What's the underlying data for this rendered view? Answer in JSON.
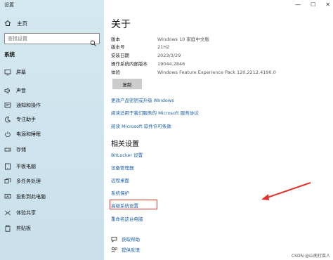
{
  "window": {
    "title": "设置"
  },
  "sidebar": {
    "home_label": "主页",
    "search_placeholder": "查找设置",
    "section_title": "系统",
    "items": [
      {
        "label": "屏幕",
        "icon": "monitor-icon"
      },
      {
        "label": "声音",
        "icon": "speaker-icon"
      },
      {
        "label": "通知和操作",
        "icon": "notification-icon"
      },
      {
        "label": "专注助手",
        "icon": "moon-icon"
      },
      {
        "label": "电源和睡眠",
        "icon": "power-icon"
      },
      {
        "label": "存储",
        "icon": "storage-icon"
      },
      {
        "label": "平板电脑",
        "icon": "tablet-icon"
      },
      {
        "label": "多任务处理",
        "icon": "multitask-icon"
      },
      {
        "label": "投影到此电脑",
        "icon": "project-icon"
      },
      {
        "label": "体验共享",
        "icon": "share-icon"
      },
      {
        "label": "剪贴板",
        "icon": "clipboard-icon"
      }
    ]
  },
  "main": {
    "title": "关于",
    "specs": [
      {
        "key": "版本",
        "value": "Windows 10 家庭中文版"
      },
      {
        "key": "版本号",
        "value": "21H2"
      },
      {
        "key": "安装日期",
        "value": "2023/3/29"
      },
      {
        "key": "操作系统内部版本",
        "value": "19044.2846"
      },
      {
        "key": "体验",
        "value": "Windows Feature Experience Pack 120.2212.4190.0"
      }
    ],
    "copy_label": "复制",
    "links_top": [
      "更改产品密钥或升级 Windows",
      "阅读适用于我们服务的 Microsoft 服务协议",
      "阅读 Microsoft 软件许可条款"
    ],
    "related_title": "相关设置",
    "related_links": [
      "BitLocker 设置",
      "设备管理器",
      "远程桌面",
      "系统保护",
      "高级系统设置",
      "重命名这台电脑"
    ],
    "help_links": [
      {
        "label": "获取帮助",
        "icon": "help-chat-icon"
      },
      {
        "label": "提供反馈",
        "icon": "feedback-icon"
      }
    ]
  },
  "watermark": "CSDN @山南打菜人",
  "colors": {
    "link": "#1a5fa8",
    "highlight": "#e0332c",
    "sidebar_bg": "#cfe4ee"
  }
}
